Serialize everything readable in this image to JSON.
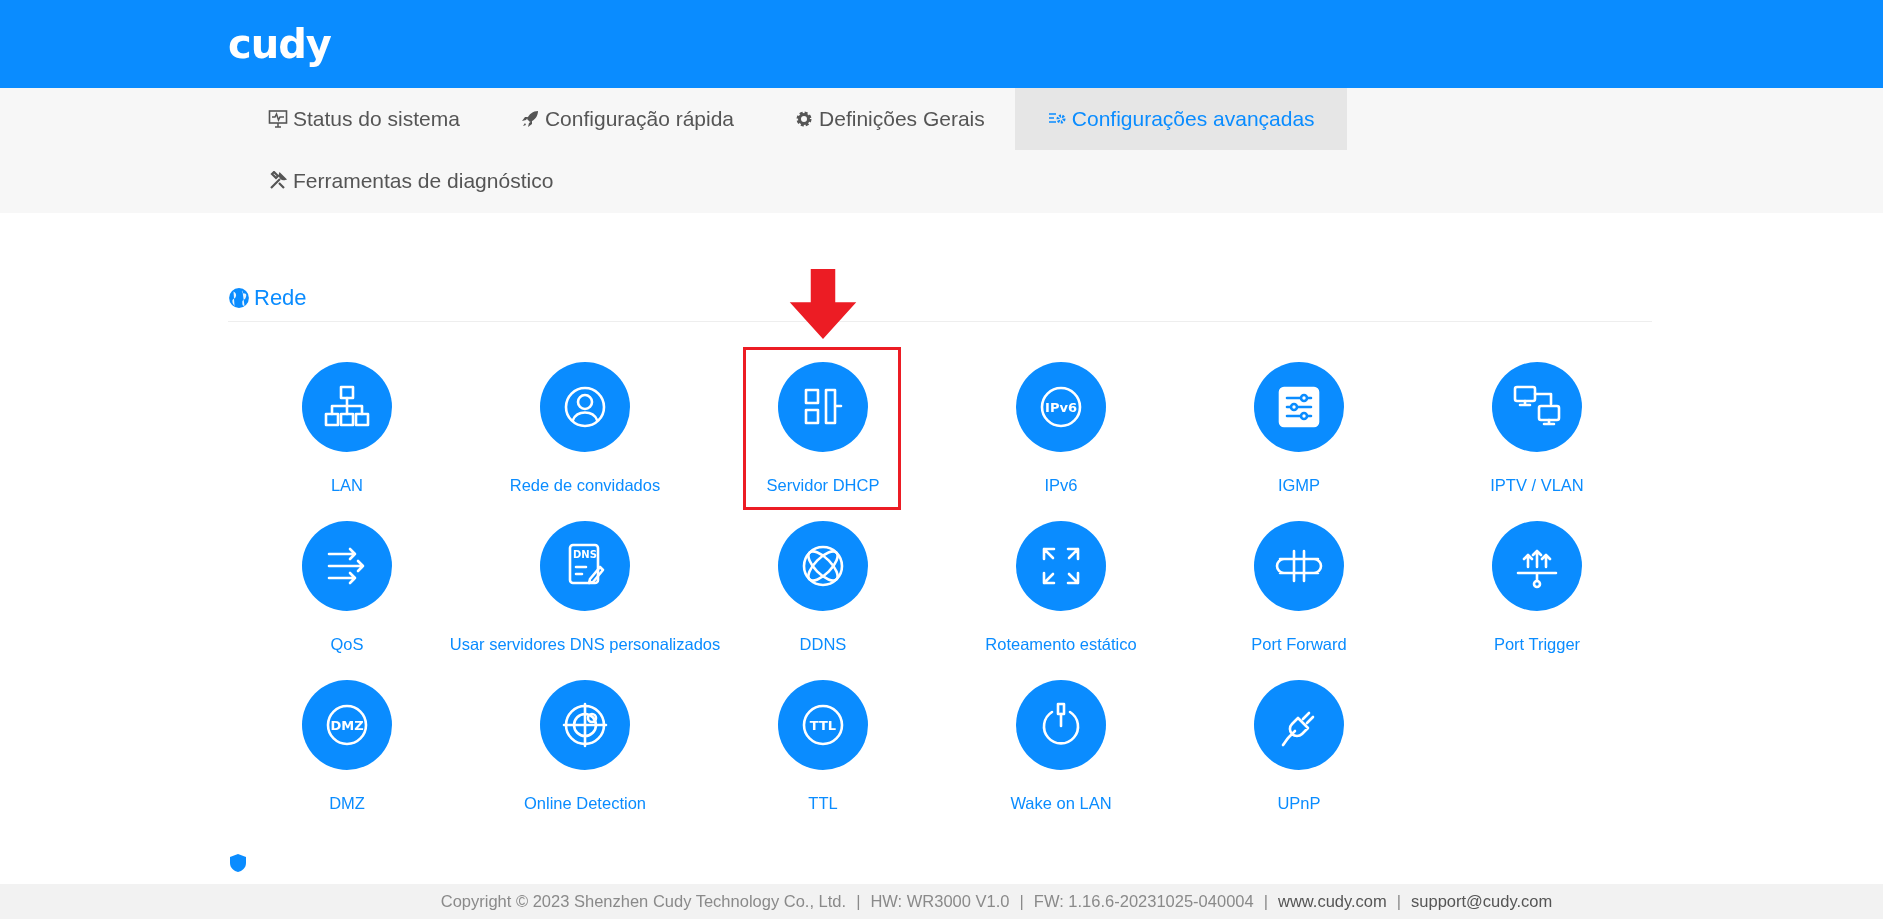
{
  "header": {
    "logo": "cudy"
  },
  "tabs": [
    {
      "label": "Status do sistema",
      "selected": false
    },
    {
      "label": "Configuração rápida",
      "selected": false
    },
    {
      "label": "Definições Gerais",
      "selected": false
    },
    {
      "label": "Configurações avançadas",
      "selected": true
    },
    {
      "label": "Ferramentas de diagnóstico",
      "selected": false
    }
  ],
  "section": {
    "title": "Rede",
    "items": [
      {
        "label": "LAN",
        "highlighted": false
      },
      {
        "label": "Rede de convidados",
        "highlighted": false
      },
      {
        "label": "Servidor DHCP",
        "highlighted": true
      },
      {
        "label": "IPv6",
        "icon_text": "IPv6",
        "highlighted": false
      },
      {
        "label": "IGMP",
        "highlighted": false
      },
      {
        "label": "IPTV / VLAN",
        "highlighted": false
      },
      {
        "label": "QoS",
        "highlighted": false
      },
      {
        "label": "Usar servidores DNS personalizados",
        "icon_text": "DNS",
        "highlighted": false
      },
      {
        "label": "DDNS",
        "highlighted": false
      },
      {
        "label": "Roteamento estático",
        "highlighted": false
      },
      {
        "label": "Port Forward",
        "highlighted": false
      },
      {
        "label": "Port Trigger",
        "highlighted": false
      },
      {
        "label": "DMZ",
        "icon_text": "DMZ",
        "highlighted": false
      },
      {
        "label": "Online Detection",
        "highlighted": false
      },
      {
        "label": "TTL",
        "icon_text": "TTL",
        "highlighted": false
      },
      {
        "label": "Wake on LAN",
        "highlighted": false
      },
      {
        "label": "UPnP",
        "highlighted": false
      }
    ]
  },
  "footer": {
    "separator": "|",
    "items": [
      {
        "text": "Copyright © 2023 Shenzhen Cudy Technology Co., Ltd.",
        "kind": "info"
      },
      {
        "text": "HW: WR3000 V1.0",
        "kind": "info"
      },
      {
        "text": "FW: 1.16.6-20231025-040004",
        "kind": "info"
      },
      {
        "text": "www.cudy.com",
        "kind": "link"
      },
      {
        "text": "support@cudy.com",
        "kind": "link"
      }
    ]
  }
}
